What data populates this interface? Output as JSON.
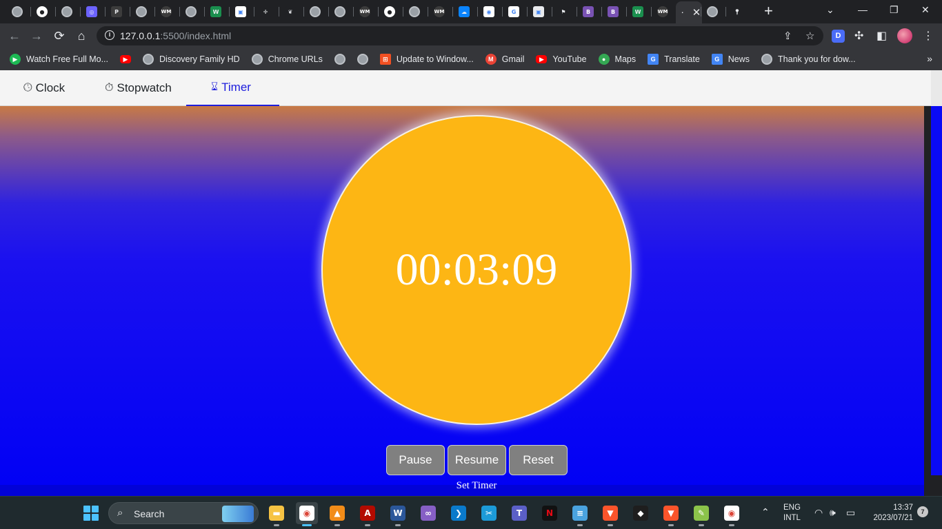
{
  "browser": {
    "tab_favicons": [
      "globe-icon",
      "github-icon",
      "globe-icon",
      "circle-app-icon",
      "p-icon",
      "globe-icon",
      "wm-icon",
      "globe-icon",
      "w-icon",
      "photo-icon",
      "grid-icon",
      "plant-icon",
      "globe-icon",
      "globe-icon",
      "wm-icon",
      "github-icon",
      "globe-icon",
      "wm-icon",
      "onedrive-icon",
      "chrome-icon",
      "google-icon",
      "profile-icon",
      "flag-icon",
      "b-icon",
      "b-icon",
      "w-icon",
      "wm-icon",
      "active-tab-icon",
      "globe-icon",
      "maps-icon"
    ],
    "new_tab_label": "+",
    "url_host": "127.0.0.1",
    "url_path": ":5500/index.html",
    "extension_label": "D"
  },
  "bookmarks": [
    {
      "label": "Watch Free Full Mo...",
      "icon": "watch-icon",
      "color": "#1db954"
    },
    {
      "label": "",
      "icon": "youtube-icon",
      "color": "#ff0000"
    },
    {
      "label": "Discovery Family HD",
      "icon": "globe-icon",
      "color": "#9aa0a6"
    },
    {
      "label": "Chrome URLs",
      "icon": "globe-icon",
      "color": "#9aa0a6"
    },
    {
      "label": "",
      "icon": "globe-icon",
      "color": "#9aa0a6"
    },
    {
      "label": "",
      "icon": "globe-icon",
      "color": "#9aa0a6"
    },
    {
      "label": "Update to Window...",
      "icon": "windows-icon",
      "color": "#f25022"
    },
    {
      "label": "Gmail",
      "icon": "gmail-icon",
      "color": "#ea4335"
    },
    {
      "label": "YouTube",
      "icon": "youtube-icon",
      "color": "#ff0000"
    },
    {
      "label": "Maps",
      "icon": "maps-icon",
      "color": "#34a853"
    },
    {
      "label": "Translate",
      "icon": "translate-icon",
      "color": "#4285f4"
    },
    {
      "label": "News",
      "icon": "news-icon",
      "color": "#4285f4"
    },
    {
      "label": "Thank you for dow...",
      "icon": "globe-icon",
      "color": "#9aa0a6"
    }
  ],
  "bookmarks_more": "»",
  "app": {
    "nav": [
      {
        "label": "Clock",
        "icon": "clock-icon",
        "glyph": "🕓︎"
      },
      {
        "label": "Stopwatch",
        "icon": "stopwatch-icon",
        "glyph": "⏱︎"
      },
      {
        "label": "Timer",
        "icon": "hourglass-icon",
        "glyph": "⌛︎"
      }
    ],
    "active_tab": "Timer",
    "timer_display": "00:03:09",
    "buttons": {
      "pause": "Pause",
      "resume": "Resume",
      "reset": "Reset"
    },
    "set_timer_label": "Set Timer",
    "colors": {
      "circle": "#fdb614",
      "active_nav": "#1d1ddd",
      "button": "#808080"
    }
  },
  "taskbar": {
    "search_label": "Search",
    "apps": [
      "file-explorer-icon",
      "chrome-icon",
      "vlc-icon",
      "acrobat-icon",
      "word-icon",
      "visual-studio-icon",
      "vscode-icon",
      "snipping-icon",
      "teams-icon",
      "netflix-icon",
      "notepad-icon",
      "brave-icon",
      "figma-icon",
      "brave-icon",
      "notepad-plus-icon",
      "chrome-icon"
    ],
    "lang_top": "ENG",
    "lang_bottom": "INTL",
    "time": "13:37",
    "date": "2023/07/21",
    "notification_count": "7"
  }
}
